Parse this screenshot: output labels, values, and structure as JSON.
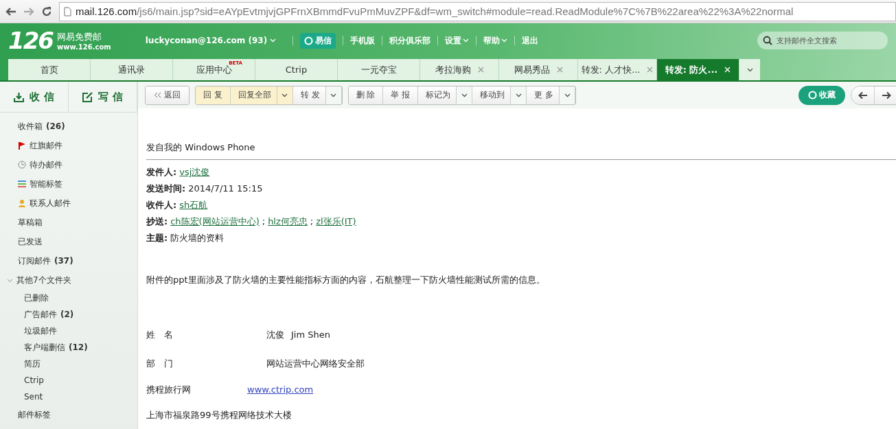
{
  "browser": {
    "url_host": "mail.126.com",
    "url_rest": "/js6/main.jsp?sid=eAYpEvtmjvjGPFrnXBmmdFvuPmMuvZPF&df=wm_switch#module=read.ReadModule%7C%7B%22area%22%3A%22normal"
  },
  "header": {
    "logo": "126",
    "brand": "网易免费邮",
    "domain": "www.126.com",
    "account": "luckyconan@126.com (93)",
    "yixin": "易信",
    "links": [
      {
        "label": "手机版",
        "dropdown": false
      },
      {
        "label": "积分俱乐部",
        "dropdown": false
      },
      {
        "label": "设置",
        "dropdown": true
      },
      {
        "label": "帮助",
        "dropdown": true
      },
      {
        "label": "退出",
        "dropdown": false
      }
    ],
    "search": {
      "placeholder": "支持邮件全文搜索"
    }
  },
  "tabs": [
    {
      "label": "首页",
      "closable": false,
      "selected": false
    },
    {
      "label": "通讯录",
      "closable": false,
      "selected": false
    },
    {
      "label": "应用中心",
      "badge": "BETA",
      "closable": false,
      "selected": false
    },
    {
      "label": "Ctrip",
      "closable": false,
      "selected": false
    },
    {
      "label": "一元夺宝",
      "closable": false,
      "selected": false
    },
    {
      "label": "考拉海购",
      "closable": true,
      "selected": false
    },
    {
      "label": "网易秀品",
      "closable": true,
      "selected": false
    },
    {
      "label": "转发: 人才快...",
      "closable": true,
      "selected": false
    },
    {
      "label": "转发: 防火...",
      "closable": true,
      "selected": true
    }
  ],
  "sidebar": {
    "receive": "收 信",
    "compose": "写 信",
    "items": [
      {
        "label": "收件箱",
        "count": "(26)"
      },
      {
        "label": "红旗邮件",
        "kind": "flag"
      },
      {
        "label": "待办邮件",
        "kind": "clock"
      },
      {
        "label": "智能标签",
        "kind": "tags"
      },
      {
        "label": "联系人邮件",
        "kind": "person"
      },
      {
        "label": "草稿箱"
      },
      {
        "label": "已发送"
      },
      {
        "label": "订阅邮件",
        "count": "(37)"
      },
      {
        "label": "其他7个文件夹",
        "expanded": true,
        "children": [
          {
            "label": "已删除"
          },
          {
            "label": "广告邮件",
            "count": "(2)"
          },
          {
            "label": "垃圾邮件"
          },
          {
            "label": "客户端删信",
            "count": "(12)"
          },
          {
            "label": "简历"
          },
          {
            "label": "Ctrip"
          },
          {
            "label": "Sent"
          }
        ]
      },
      {
        "label": "邮件标签"
      }
    ]
  },
  "toolbar": {
    "back": "返回",
    "groups": [
      [
        {
          "label": "回 复",
          "highlight": true,
          "dropdown": false
        },
        {
          "label": "回复全部",
          "highlight": true,
          "dropdown": true
        },
        {
          "label": "转 发",
          "highlight": false,
          "dropdown": true
        }
      ],
      [
        {
          "label": "删 除",
          "highlight": false,
          "dropdown": false
        },
        {
          "label": "举 报",
          "highlight": false,
          "dropdown": false
        },
        {
          "label": "标记为",
          "highlight": false,
          "dropdown": true
        },
        {
          "label": "移动到",
          "highlight": false,
          "dropdown": true
        },
        {
          "label": "更 多",
          "highlight": false,
          "dropdown": true
        }
      ]
    ],
    "save": "收藏"
  },
  "email": {
    "sent_from": "发自我的 Windows Phone",
    "fields": [
      {
        "label": "发件人:",
        "parts": [
          {
            "kind": "link",
            "text": "vsj沈俊"
          }
        ]
      },
      {
        "label": "发送时间:",
        "parts": [
          {
            "kind": "text",
            "text": "2014/7/11 15:15"
          }
        ]
      },
      {
        "label": "收件人:",
        "parts": [
          {
            "kind": "link",
            "text": "sh石航"
          }
        ]
      },
      {
        "label": "抄送:",
        "parts": [
          {
            "kind": "link",
            "text": "ch陈宏(网站运营中心)"
          },
          {
            "kind": "text",
            "text": ";"
          },
          {
            "kind": "link",
            "text": "hlz何亮忠"
          },
          {
            "kind": "text",
            "text": ";"
          },
          {
            "kind": "link",
            "text": "zl张乐(IT)"
          }
        ]
      },
      {
        "label": "主题:",
        "parts": [
          {
            "kind": "text",
            "text": "防火墙的资料"
          }
        ]
      }
    ],
    "body": "附件的ppt里面涉及了防火墙的主要性能指标方面的内容，石航整理一下防火墙性能测试所需的信息。",
    "signature": [
      {
        "label": "姓　名",
        "value": "沈俊",
        "value_en": "Jim Shen"
      },
      {
        "label": "部　门",
        "value": "网站运营中心网络安全部"
      }
    ],
    "company": {
      "label": "携程旅行网",
      "link": "www.ctrip.com"
    },
    "address": "上海市福泉路99号携程网络技术大楼"
  }
}
